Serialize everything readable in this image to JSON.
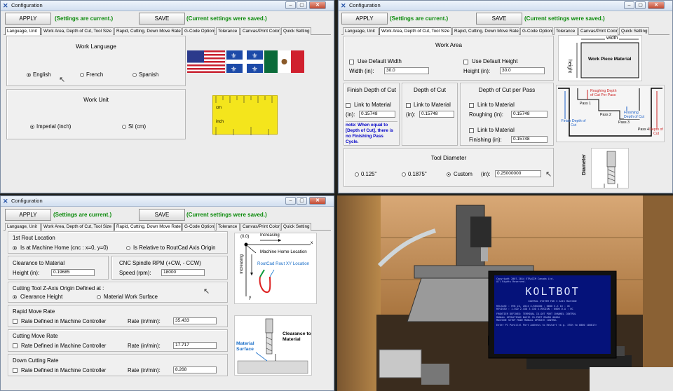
{
  "common": {
    "window_title": "Configuration",
    "apply_label": "APPLY",
    "save_label": "SAVE",
    "status_current": "(Settings are current.)",
    "status_saved": "(Current settings were saved.)",
    "tabs": [
      "Language, Unit",
      "Work Area, Depth of Cut, Tool Size",
      "Rapid, Cutting, Down Move Rate",
      "G-Code Options",
      "Tolerance",
      "Canvas/Print Color",
      "Quick Setting"
    ],
    "win_min": "–",
    "win_max": "▢",
    "win_close": "✕"
  },
  "win1": {
    "active_tab": "Language, Unit",
    "language": {
      "title": "Work Language",
      "options": [
        "English",
        "French",
        "Spanish"
      ],
      "selected": "English"
    },
    "unit": {
      "title": "Work Unit",
      "options": [
        "Imperial (inch)",
        "SI (cm)"
      ],
      "selected": "Imperial (inch)"
    },
    "flag_icons": [
      "us-flag-icon",
      "quebec-flag-icon",
      "mexico-flag-icon"
    ],
    "ruler_icon": "ruler-icon",
    "ruler_text": {
      "top": "cm",
      "bottom": "inch"
    }
  },
  "win2": {
    "active_tab": "Work Area, Depth of Cut, Tool Size",
    "work_area": {
      "title": "Work Area",
      "use_default_width": "Use Default Width",
      "use_default_height": "Use Default Height",
      "width_label": "Width   (in):",
      "width_value": "30.0",
      "height_label": "Height (in):",
      "height_value": "30.0"
    },
    "finish_depth": {
      "title": "Finish Depth of Cut",
      "link_label": "Link to Material",
      "in_label": "(in):",
      "value": "0.15748",
      "note": "note: When equal to [Depth of Cut], there is no Finishing Pass Cycle."
    },
    "depth_of_cut": {
      "title": "Depth of Cut",
      "link_label": "Link to Material",
      "in_label": "(in):",
      "value": "0.15748"
    },
    "depth_per_pass": {
      "title": "Depth of Cut per Pass",
      "link1_label": "Link to Material",
      "roughing_label": "Roughing (in):",
      "roughing_value": "0.15748",
      "link2_label": "Link to Material",
      "finishing_label": "Finishing (in):",
      "finishing_value": "0.15748"
    },
    "tool_diameter": {
      "title": "Tool Diameter",
      "options": [
        "0.125\"",
        "0.1875\"",
        "Custom"
      ],
      "selected": "Custom",
      "in_label": "(in):",
      "value": "0.25000000"
    },
    "diagram_top": {
      "width": "width",
      "height": "height",
      "label": "Work Piece Material"
    },
    "diagram_mid": {
      "roughing": "Roughing Depth of Cut Per Pass",
      "finishing": "Finishing Depth of Cut",
      "pass1": "Pass 1",
      "pass2": "Pass 2",
      "pass3": "Pass 3",
      "pass4": "Pass 4",
      "finish": "Finish Depth of Cut",
      "depth": "Depth of Cut"
    },
    "diagram_tool": {
      "label": "Diameter"
    }
  },
  "win3": {
    "active_tab": "Rapid, Cutting, Down Move Rate",
    "first_rout": {
      "title": "1st Rout Location",
      "opt1": "Is at Machine Home (cnc : x=0, y=0)",
      "opt2": "Is Relative to RoutCad Axis Origin",
      "selected": "Is at Machine Home (cnc : x=0, y=0)"
    },
    "clearance": {
      "title": "Clearance to Material",
      "height_label": "Height  (in):",
      "height_value": "0.19685"
    },
    "spindle": {
      "title": "CNC Spindle RPM (+CW, - CCW)",
      "speed_label": "Speed   (rpm):",
      "speed_value": "18000"
    },
    "z_origin": {
      "title": "Cutting Tool Z-Axis Origin Defined at :",
      "opt1": "Clearance Height",
      "opt2": "Material Work Surface",
      "selected": "Clearance Height"
    },
    "rapid": {
      "title": "Rapid Move Rate",
      "chk_label": "Rate Defined in Machine Controller",
      "rate_label": "Rate    (in/min):",
      "value": "35.433"
    },
    "cutting": {
      "title": "Cutting Move Rate",
      "chk_label": "Rate Defined in Machine Controller",
      "rate_label": "Rate    (in/min):",
      "value": "17.717"
    },
    "down": {
      "title": "Down Cutting Rate",
      "chk_label": "Rate Defined in Machine Controller",
      "rate_label": "Rate    (in/min):",
      "value": "8.268"
    },
    "diagram_axes": {
      "origin": "(0,0)",
      "increasing": "Increasing",
      "x": "x",
      "y": "y",
      "home": "Machine Home Location",
      "rout": "RoutCad Rout XY Location"
    },
    "diagram_clear": {
      "clearance": "Clearance to Material",
      "surface": "Material Surface"
    }
  },
  "photo": {
    "screen_title": "KOLTBOT",
    "screen_lines": [
      "Copyright 2007-2014 ETRACIM Canada Ltd.",
      "All Rights Reserved.",
      "CONTROL SYSTEM FOR 3 AXIS MACHINE",
      "RELEASE : FEB 24, 2014  X-REGION : 0000  S-X 16 : 0C",
      "REVISED : 1-COD 2-COD 3-COD  X-REGION : 0000  D-A : 0C",
      "FRONTIER DEFINED: TERMINAL   IO-OUT PORT CHANNEL CONTROL",
      "MANUAL OPERATIONS BASIS     CO-PORT BOARD 00000",
      "MACHINE SETUP MODE          MANUAL OPERATE CONTROL",
      "Enter PC Parallel Port Address to Restart <e.g. 378h to 0000 100017>"
    ]
  }
}
